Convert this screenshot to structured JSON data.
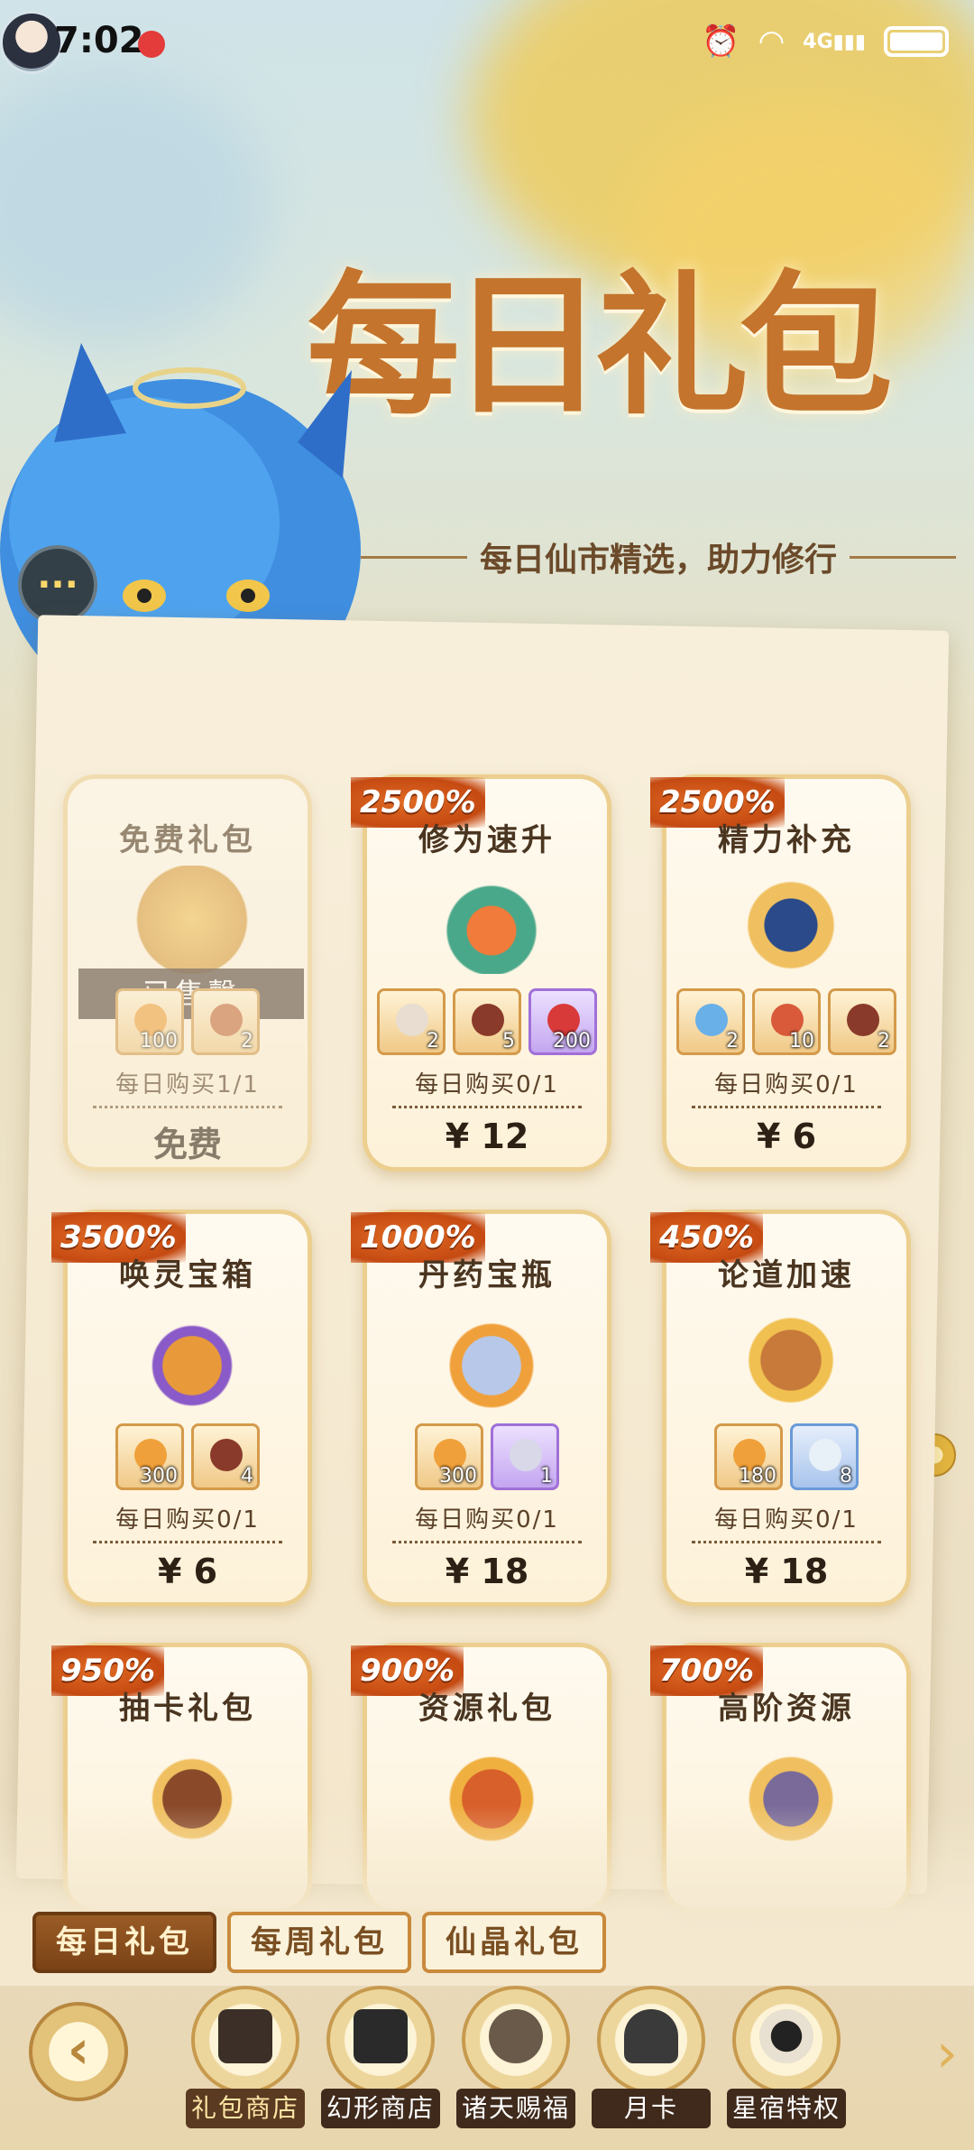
{
  "status_bar": {
    "time": "7:02",
    "network": "4G"
  },
  "banner": {
    "title": "每日礼包",
    "subtitle": "每日仙市精选，助力修行"
  },
  "cards": [
    {
      "name": "免费礼包",
      "badge": "",
      "sold_out_label": "已售罄",
      "items": [
        {
          "count": "100",
          "rarity": "orange"
        },
        {
          "count": "2",
          "rarity": "orange"
        }
      ],
      "limit": "每日购买1/1",
      "price": "免费",
      "faded": true
    },
    {
      "name": "修为速升",
      "badge": "2500%",
      "items": [
        {
          "count": "2",
          "rarity": "orange"
        },
        {
          "count": "5",
          "rarity": "orange"
        },
        {
          "count": "200",
          "rarity": "purple"
        }
      ],
      "limit": "每日购买0/1",
      "price": "¥ 12"
    },
    {
      "name": "精力补充",
      "badge": "2500%",
      "items": [
        {
          "count": "2",
          "rarity": "orange"
        },
        {
          "count": "10",
          "rarity": "orange"
        },
        {
          "count": "2",
          "rarity": "orange"
        }
      ],
      "limit": "每日购买0/1",
      "price": "¥ 6"
    },
    {
      "name": "唤灵宝箱",
      "badge": "3500%",
      "items": [
        {
          "count": "300",
          "rarity": "orange"
        },
        {
          "count": "4",
          "rarity": "orange"
        }
      ],
      "limit": "每日购买0/1",
      "price": "¥ 6"
    },
    {
      "name": "丹药宝瓶",
      "badge": "1000%",
      "items": [
        {
          "count": "300",
          "rarity": "orange"
        },
        {
          "count": "1",
          "rarity": "purple"
        }
      ],
      "limit": "每日购买0/1",
      "price": "¥ 18"
    },
    {
      "name": "论道加速",
      "badge": "450%",
      "items": [
        {
          "count": "180",
          "rarity": "orange"
        },
        {
          "count": "8",
          "rarity": "blue"
        }
      ],
      "limit": "每日购买0/1",
      "price": "¥ 18"
    },
    {
      "name": "抽卡礼包",
      "badge": "950%"
    },
    {
      "name": "资源礼包",
      "badge": "900%"
    },
    {
      "name": "高阶资源",
      "badge": "700%"
    }
  ],
  "tabs": [
    "每日礼包",
    "每周礼包",
    "仙晶礼包"
  ],
  "nav": [
    "礼包商店",
    "幻形商店",
    "诸天赐福",
    "月卡",
    "星宿特权"
  ],
  "colors": {
    "accent": "#c4742c",
    "badge": "#d1561a",
    "purple": "#a070d8"
  }
}
